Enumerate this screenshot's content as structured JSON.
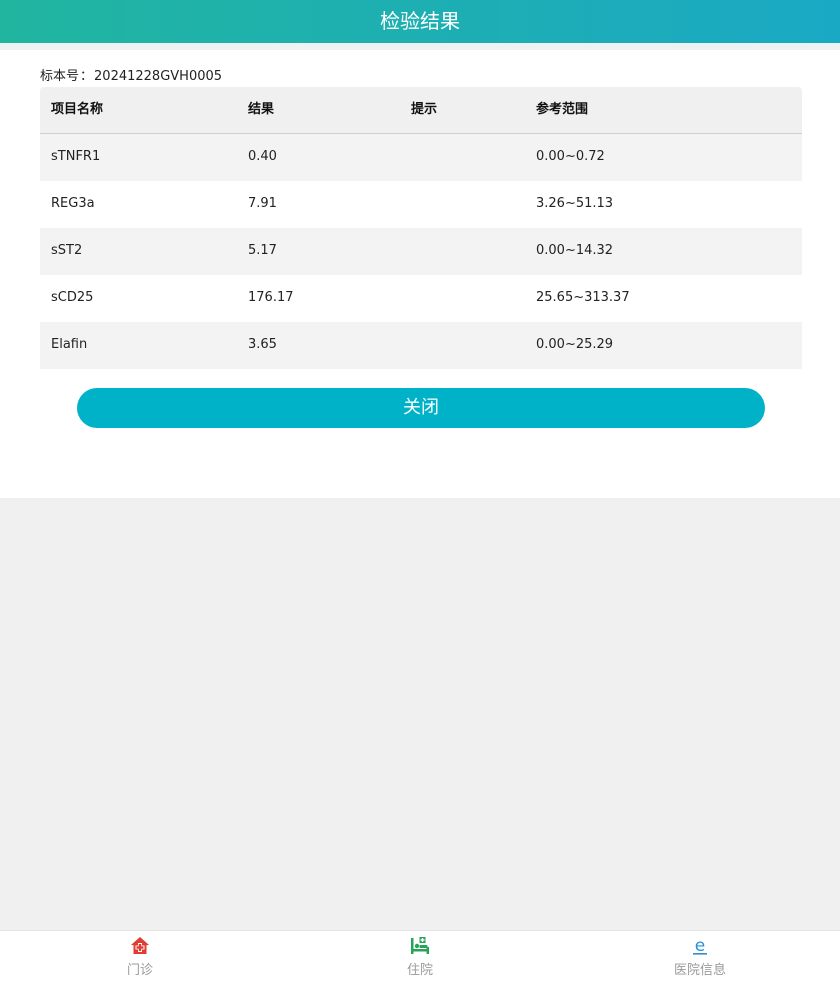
{
  "header": {
    "title": "检验结果"
  },
  "specimen": {
    "label": "标本号",
    "separator": "：",
    "value": "20241228GVH0005"
  },
  "table": {
    "columns": [
      "项目名称",
      "结果",
      "提示",
      "参考范围"
    ],
    "rows": [
      {
        "name": "sTNFR1",
        "result": "0.40",
        "hint": "",
        "range": "0.00~0.72"
      },
      {
        "name": "REG3a",
        "result": "7.91",
        "hint": "",
        "range": "3.26~51.13"
      },
      {
        "name": "sST2",
        "result": "5.17",
        "hint": "",
        "range": "0.00~14.32"
      },
      {
        "name": "sCD25",
        "result": "176.17",
        "hint": "",
        "range": "25.65~313.37"
      },
      {
        "name": "Elafin",
        "result": "3.65",
        "hint": "",
        "range": "0.00~25.29"
      }
    ]
  },
  "actions": {
    "close_label": "关闭"
  },
  "tabbar": {
    "items": [
      {
        "label": "门诊",
        "icon": "clinic-house-icon",
        "color": "#e23b32"
      },
      {
        "label": "住院",
        "icon": "hospital-bed-icon",
        "color": "#27a35a"
      },
      {
        "label": "医院信息",
        "icon": "hospital-info-e-icon",
        "color": "#2a8fd6"
      }
    ]
  },
  "colors": {
    "header_start": "#21b5a0",
    "header_end": "#1aa9c4",
    "button": "#00b2c8"
  }
}
